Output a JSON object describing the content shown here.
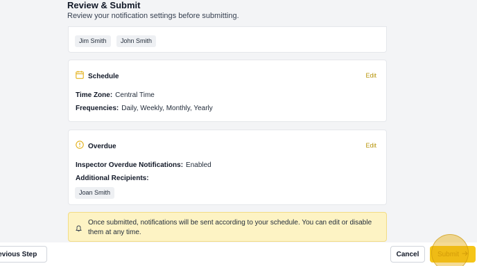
{
  "header": {
    "title": "Review & Submit",
    "subtitle": "Review your notification settings before submitting."
  },
  "recipients_card": {
    "chips": [
      "Jim Smith",
      "John Smith"
    ]
  },
  "schedule": {
    "title": "Schedule",
    "edit_label": "Edit",
    "icon": "calendar-icon",
    "timezone_label": "Time Zone:",
    "timezone_value": "Central Time",
    "frequencies_label": "Frequencies:",
    "frequencies_value": "Daily, Weekly, Monthly, Yearly"
  },
  "overdue": {
    "title": "Overdue",
    "edit_label": "Edit",
    "icon": "alert-circle-icon",
    "inspector_label": "Inspector Overdue Notifications:",
    "inspector_value": "Enabled",
    "additional_label": "Additional Recipients:",
    "chips": [
      "Joan Smith"
    ]
  },
  "notice": {
    "icon": "bell-icon",
    "text": "Once submitted, notifications will be sent according to your schedule. You can edit or disable them at any time."
  },
  "footer": {
    "previous_label": "Previous Step",
    "cancel_label": "Cancel",
    "submit_label": "Submit",
    "submit_icon": "arrow-right-icon"
  },
  "colors": {
    "accent": "#f5c518",
    "edit_link": "#b7950b",
    "notice_bg": "#fdf3c4"
  }
}
